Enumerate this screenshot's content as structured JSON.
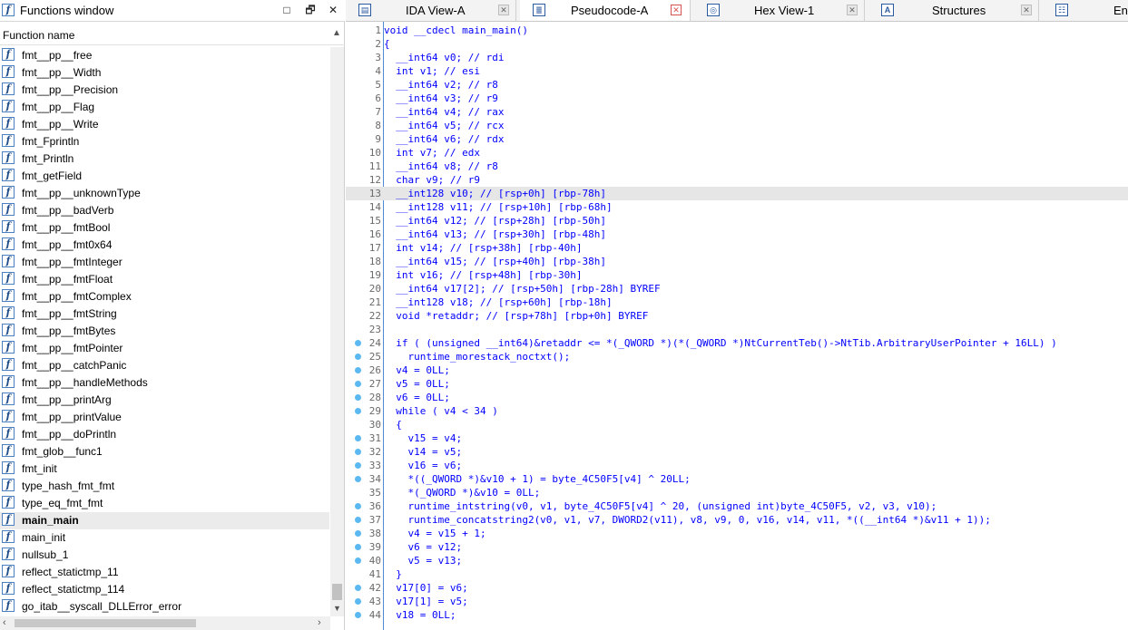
{
  "functions_window": {
    "title": "Functions window",
    "column_header": "Function name",
    "buttons": {
      "minimize": "□",
      "restore": "🗗",
      "close": "✕"
    },
    "items": [
      "fmt__pp__free",
      "fmt__pp__Width",
      "fmt__pp__Precision",
      "fmt__pp__Flag",
      "fmt__pp__Write",
      "fmt_Fprintln",
      "fmt_Println",
      "fmt_getField",
      "fmt__pp__unknownType",
      "fmt__pp__badVerb",
      "fmt__pp__fmtBool",
      "fmt__pp__fmt0x64",
      "fmt__pp__fmtInteger",
      "fmt__pp__fmtFloat",
      "fmt__pp__fmtComplex",
      "fmt__pp__fmtString",
      "fmt__pp__fmtBytes",
      "fmt__pp__fmtPointer",
      "fmt__pp__catchPanic",
      "fmt__pp__handleMethods",
      "fmt__pp__printArg",
      "fmt__pp__printValue",
      "fmt__pp__doPrintln",
      "fmt_glob__func1",
      "fmt_init",
      "type_hash_fmt_fmt",
      "type_eq_fmt_fmt",
      "main_main",
      "main_init",
      "nullsub_1",
      "reflect_statictmp_11",
      "reflect_statictmp_114",
      "go_itab__syscall_DLLError_error"
    ],
    "selected": "main_main",
    "icon_glyph": "f"
  },
  "tabs": [
    {
      "label": "IDA View-A",
      "icon": "ida-view-icon",
      "glyph": "▤",
      "active": false
    },
    {
      "label": "Pseudocode-A",
      "icon": "pseudocode-icon",
      "glyph": "≣",
      "active": true
    },
    {
      "label": "Hex View-1",
      "icon": "hex-view-icon",
      "glyph": "◎",
      "active": false
    },
    {
      "label": "Structures",
      "icon": "structures-icon",
      "glyph": "A",
      "active": false
    },
    {
      "label": "En",
      "icon": "enums-icon",
      "glyph": "☷",
      "active": false
    }
  ],
  "pseudocode": {
    "highlighted_line": 13,
    "lines": [
      {
        "n": "1",
        "bp": false,
        "text": "void __cdecl main_main()"
      },
      {
        "n": "2",
        "bp": false,
        "text": "{"
      },
      {
        "n": "3",
        "bp": false,
        "text": "  __int64 v0; // rdi"
      },
      {
        "n": "4",
        "bp": false,
        "text": "  int v1; // esi"
      },
      {
        "n": "5",
        "bp": false,
        "text": "  __int64 v2; // r8"
      },
      {
        "n": "6",
        "bp": false,
        "text": "  __int64 v3; // r9"
      },
      {
        "n": "7",
        "bp": false,
        "text": "  __int64 v4; // rax"
      },
      {
        "n": "8",
        "bp": false,
        "text": "  __int64 v5; // rcx"
      },
      {
        "n": "9",
        "bp": false,
        "text": "  __int64 v6; // rdx"
      },
      {
        "n": "10",
        "bp": false,
        "text": "  int v7; // edx"
      },
      {
        "n": "11",
        "bp": false,
        "text": "  __int64 v8; // r8"
      },
      {
        "n": "12",
        "bp": false,
        "text": "  char v9; // r9"
      },
      {
        "n": "13",
        "bp": false,
        "text": "  __int128 v10; // [rsp+0h] [rbp-78h]"
      },
      {
        "n": "14",
        "bp": false,
        "text": "  __int128 v11; // [rsp+10h] [rbp-68h]"
      },
      {
        "n": "15",
        "bp": false,
        "text": "  __int64 v12; // [rsp+28h] [rbp-50h]"
      },
      {
        "n": "16",
        "bp": false,
        "text": "  __int64 v13; // [rsp+30h] [rbp-48h]"
      },
      {
        "n": "17",
        "bp": false,
        "text": "  int v14; // [rsp+38h] [rbp-40h]"
      },
      {
        "n": "18",
        "bp": false,
        "text": "  __int64 v15; // [rsp+40h] [rbp-38h]"
      },
      {
        "n": "19",
        "bp": false,
        "text": "  int v16; // [rsp+48h] [rbp-30h]"
      },
      {
        "n": "20",
        "bp": false,
        "text": "  __int64 v17[2]; // [rsp+50h] [rbp-28h] BYREF"
      },
      {
        "n": "21",
        "bp": false,
        "text": "  __int128 v18; // [rsp+60h] [rbp-18h]"
      },
      {
        "n": "22",
        "bp": false,
        "text": "  void *retaddr; // [rsp+78h] [rbp+0h] BYREF"
      },
      {
        "n": "23",
        "bp": false,
        "text": ""
      },
      {
        "n": "24",
        "bp": true,
        "text": "  if ( (unsigned __int64)&retaddr <= *(_QWORD *)(*(_QWORD *)NtCurrentTeb()->NtTib.ArbitraryUserPointer + 16LL) )"
      },
      {
        "n": "25",
        "bp": true,
        "text": "    runtime_morestack_noctxt();"
      },
      {
        "n": "26",
        "bp": true,
        "text": "  v4 = 0LL;"
      },
      {
        "n": "27",
        "bp": true,
        "text": "  v5 = 0LL;"
      },
      {
        "n": "28",
        "bp": true,
        "text": "  v6 = 0LL;"
      },
      {
        "n": "29",
        "bp": true,
        "text": "  while ( v4 < 34 )"
      },
      {
        "n": "30",
        "bp": false,
        "text": "  {"
      },
      {
        "n": "31",
        "bp": true,
        "text": "    v15 = v4;"
      },
      {
        "n": "32",
        "bp": true,
        "text": "    v14 = v5;"
      },
      {
        "n": "33",
        "bp": true,
        "text": "    v16 = v6;"
      },
      {
        "n": "34",
        "bp": true,
        "text": "    *((_QWORD *)&v10 + 1) = byte_4C50F5[v4] ^ 20LL;"
      },
      {
        "n": "35",
        "bp": false,
        "text": "    *(_QWORD *)&v10 = 0LL;"
      },
      {
        "n": "36",
        "bp": true,
        "text": "    runtime_intstring(v0, v1, byte_4C50F5[v4] ^ 20, (unsigned int)byte_4C50F5, v2, v3, v10);"
      },
      {
        "n": "37",
        "bp": true,
        "text": "    runtime_concatstring2(v0, v1, v7, DWORD2(v11), v8, v9, 0, v16, v14, v11, *((__int64 *)&v11 + 1));"
      },
      {
        "n": "38",
        "bp": true,
        "text": "    v4 = v15 + 1;"
      },
      {
        "n": "39",
        "bp": true,
        "text": "    v6 = v12;"
      },
      {
        "n": "40",
        "bp": true,
        "text": "    v5 = v13;"
      },
      {
        "n": "41",
        "bp": false,
        "text": "  }"
      },
      {
        "n": "42",
        "bp": true,
        "text": "  v17[0] = v6;"
      },
      {
        "n": "43",
        "bp": true,
        "text": "  v17[1] = v5;"
      },
      {
        "n": "44",
        "bp": true,
        "text": "  v18 = 0LL;"
      }
    ]
  }
}
